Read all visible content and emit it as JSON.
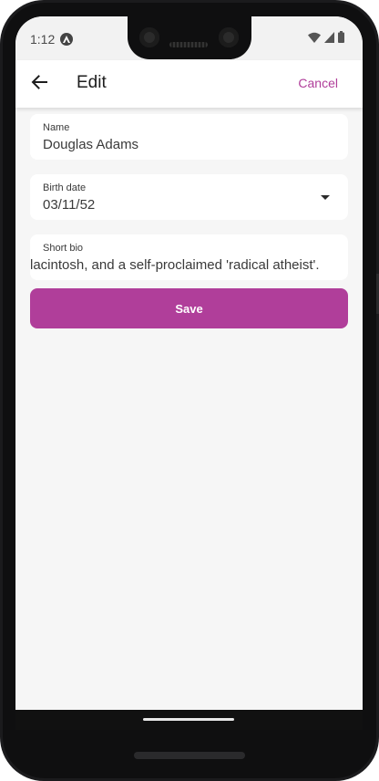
{
  "status_bar": {
    "time": "1:12",
    "app_icon": "notification-a-icon",
    "icons": [
      "wifi-icon",
      "cell-signal-icon",
      "battery-icon"
    ]
  },
  "app_bar": {
    "back_icon": "arrow-left-icon",
    "title": "Edit",
    "cancel_label": "Cancel"
  },
  "form": {
    "name": {
      "label": "Name",
      "value": "Douglas Adams"
    },
    "birth_date": {
      "label": "Birth date",
      "value": "03/11/52",
      "icon": "dropdown-arrow-icon"
    },
    "short_bio": {
      "label": "Short bio",
      "value": "lacintosh, and a self-proclaimed 'radical atheist'."
    },
    "save_label": "Save"
  },
  "colors": {
    "accent": "#b03e9a",
    "background": "#f6f6f6",
    "card": "#ffffff"
  }
}
